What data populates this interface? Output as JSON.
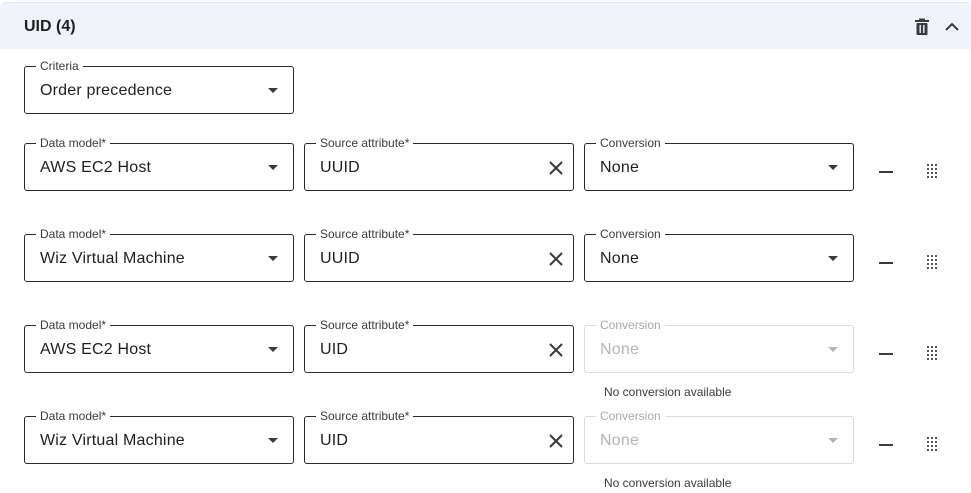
{
  "header": {
    "title": "UID (4)",
    "delete_icon": "trash-icon",
    "collapse_icon": "chevron-up-icon"
  },
  "criteria": {
    "label": "Criteria",
    "value": "Order precedence"
  },
  "rows": [
    {
      "data_model_label": "Data model*",
      "data_model": "AWS EC2 Host",
      "source_label": "Source attribute*",
      "source": "UUID",
      "conversion_label": "Conversion",
      "conversion": "None",
      "conversion_disabled": false,
      "helper": ""
    },
    {
      "data_model_label": "Data model*",
      "data_model": "Wiz Virtual Machine",
      "source_label": "Source attribute*",
      "source": "UUID",
      "conversion_label": "Conversion",
      "conversion": "None",
      "conversion_disabled": false,
      "helper": ""
    },
    {
      "data_model_label": "Data model*",
      "data_model": "AWS EC2 Host",
      "source_label": "Source attribute*",
      "source": "UID",
      "conversion_label": "Conversion",
      "conversion": "None",
      "conversion_disabled": true,
      "helper": "No conversion available"
    },
    {
      "data_model_label": "Data model*",
      "data_model": "Wiz Virtual Machine",
      "source_label": "Source attribute*",
      "source": "UID",
      "conversion_label": "Conversion",
      "conversion": "None",
      "conversion_disabled": true,
      "helper": "No conversion available"
    }
  ]
}
